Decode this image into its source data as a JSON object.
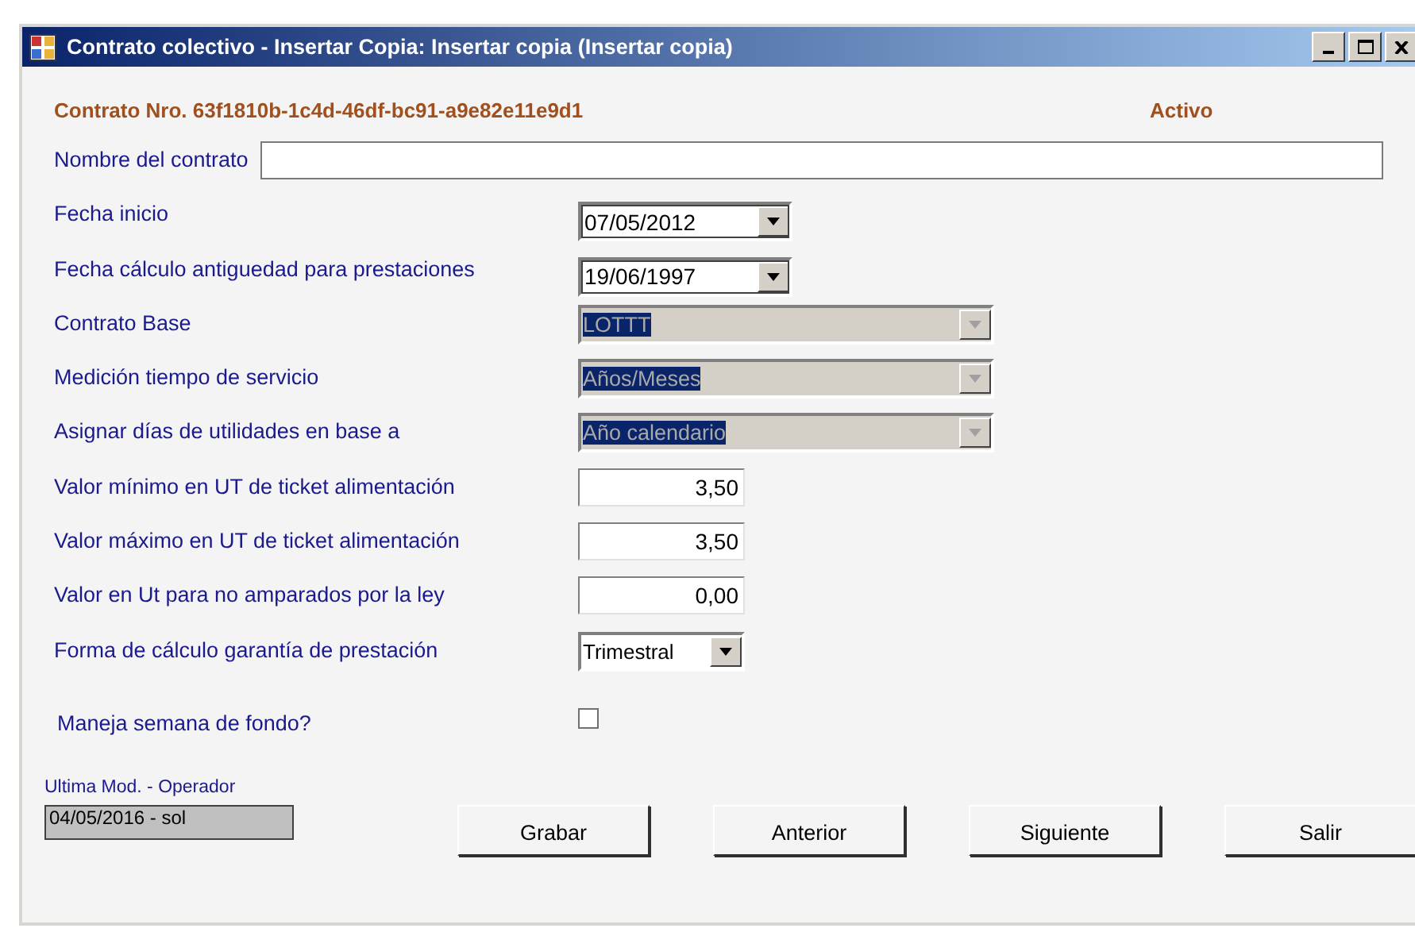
{
  "window": {
    "title": "Contrato colectivo - Insertar Copia: Insertar copia (Insertar copia)"
  },
  "header": {
    "contract_number": "Contrato Nro. 63f1810b-1c4d-46df-bc91-a9e82e11e9d1",
    "status": "Activo"
  },
  "fields": [
    {
      "kind": "text",
      "label": "Nombre del contrato"
    },
    {
      "kind": "date",
      "label": "Fecha inicio",
      "value": "07/05/2012"
    },
    {
      "kind": "date",
      "label": "Fecha cálculo antiguedad para prestaciones",
      "value": "19/06/1997"
    },
    {
      "kind": "combo",
      "label": "Contrato Base",
      "value": "LOTTT",
      "disabled": true
    },
    {
      "kind": "combo",
      "label": "Medición tiempo de servicio",
      "value": "Años/Meses",
      "disabled": true
    },
    {
      "kind": "combo",
      "label": "Asignar días de utilidades en base a",
      "value": "Año calendario",
      "disabled": true
    },
    {
      "kind": "number",
      "label": "Valor mínimo en UT de ticket alimentación",
      "value": "3,50"
    },
    {
      "kind": "number",
      "label": "Valor máximo en UT de ticket alimentación",
      "value": "3,50"
    },
    {
      "kind": "number",
      "label": "Valor en Ut para no amparados por la ley",
      "value": "0,00"
    },
    {
      "kind": "combo",
      "label": "Forma de cálculo garantía  de prestación",
      "value": "Trimestral",
      "disabled": false
    },
    {
      "kind": "checkbox",
      "label": "Maneja semana de fondo?",
      "checked": false
    }
  ],
  "footer": {
    "last_mod_label": "Ultima Mod. - Operador",
    "last_mod_value": "04/05/2016 - sol"
  },
  "buttons": [
    "Grabar",
    "Anterior",
    "Siguiente",
    "Salir"
  ]
}
